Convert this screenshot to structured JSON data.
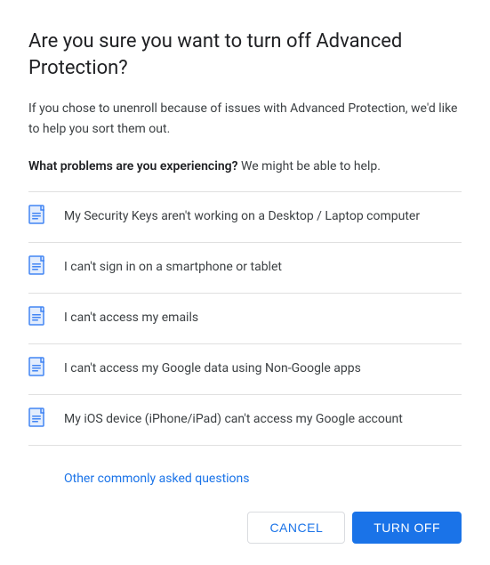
{
  "dialog": {
    "title": "Are you sure you want to turn off Advanced Protection?",
    "subtitle": "If you chose to unenroll because of issues with Advanced Protection, we'd like to help you sort them out.",
    "problems_intro_bold": "What problems are you experiencing?",
    "problems_intro_rest": " We might be able to help.",
    "list_items": [
      {
        "id": "item-1",
        "text": "My Security Keys aren't working on a Desktop / Laptop computer"
      },
      {
        "id": "item-2",
        "text": "I can't sign in on a smartphone or tablet"
      },
      {
        "id": "item-3",
        "text": "I can't access my emails"
      },
      {
        "id": "item-4",
        "text": "I can't access my Google data using Non-Google apps"
      },
      {
        "id": "item-5",
        "text": "My iOS device (iPhone/iPad) can't access my Google account"
      }
    ],
    "other_questions_label": "Other commonly asked questions",
    "cancel_label": "CANCEL",
    "turnoff_label": "TURN OFF"
  }
}
